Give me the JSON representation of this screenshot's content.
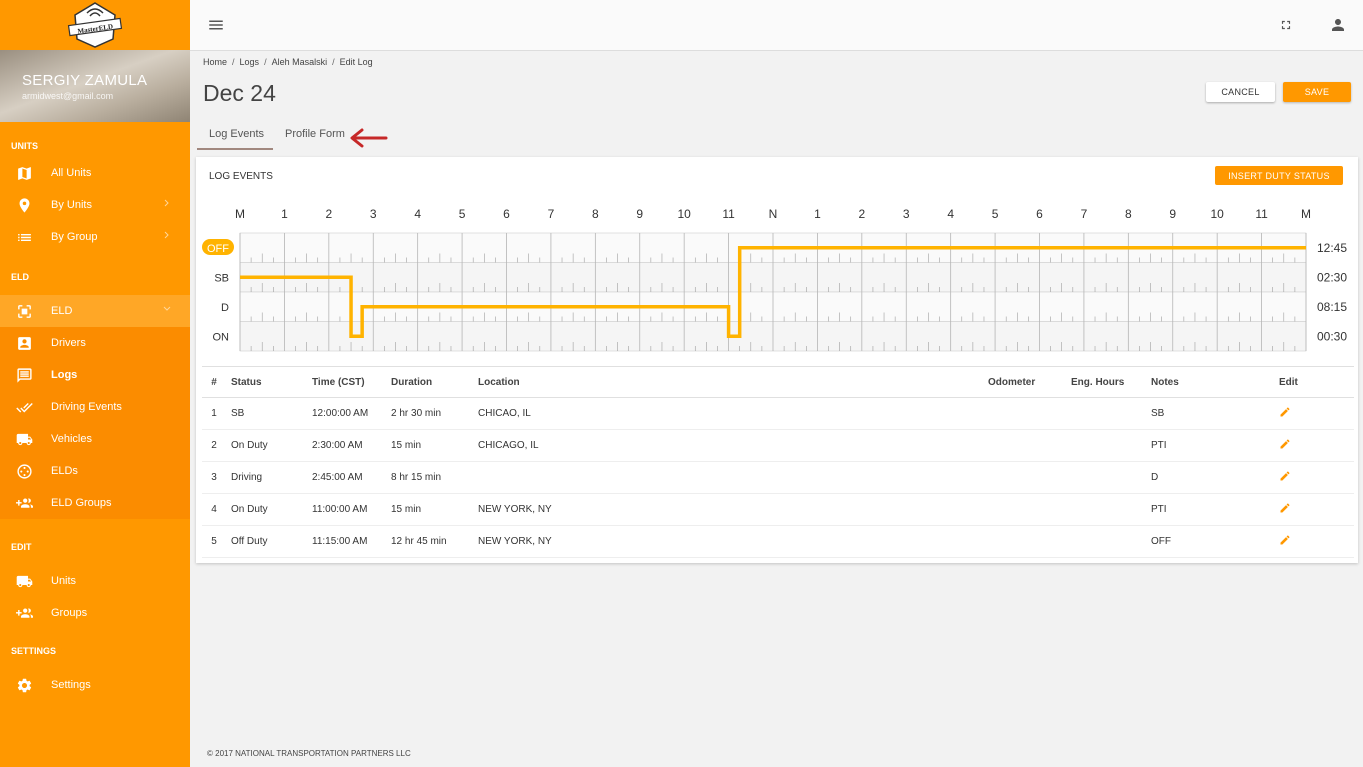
{
  "app": {
    "logo_text": "MasterELD"
  },
  "user": {
    "name": "SERGIY ZAMULA",
    "email": "armidwest@gmail.com"
  },
  "sidebar": {
    "sections": {
      "units": "UNITS",
      "eld": "ELD",
      "edit": "EDIT",
      "settings": "SETTINGS"
    },
    "items": {
      "all_units": "All Units",
      "by_units": "By Units",
      "by_group": "By Group",
      "eld": "ELD",
      "drivers": "Drivers",
      "logs": "Logs",
      "driving_events": "Driving Events",
      "vehicles": "Vehicles",
      "elds": "ELDs",
      "eld_groups": "ELD Groups",
      "units": "Units",
      "groups": "Groups",
      "settings": "Settings"
    }
  },
  "breadcrumb": [
    "Home",
    "Logs",
    "Aleh Masalski",
    "Edit Log"
  ],
  "page": {
    "title": "Dec 24",
    "cancel_label": "CANCEL",
    "save_label": "SAVE"
  },
  "tabs": {
    "log_events": "Log Events",
    "profile_form": "Profile Form"
  },
  "card": {
    "title": "LOG EVENTS",
    "insert_label": "INSERT DUTY STATUS"
  },
  "chart_data": {
    "type": "line",
    "hour_labels": [
      "M",
      "1",
      "2",
      "3",
      "4",
      "5",
      "6",
      "7",
      "8",
      "9",
      "10",
      "11",
      "N",
      "1",
      "2",
      "3",
      "4",
      "5",
      "6",
      "7",
      "8",
      "9",
      "10",
      "11",
      "M"
    ],
    "rows": [
      "OFF",
      "SB",
      "D",
      "ON"
    ],
    "totals": [
      "12:45",
      "02:30",
      "08:15",
      "00:30"
    ],
    "segments": [
      {
        "status": "SB",
        "start": 0,
        "end": 2.5
      },
      {
        "status": "ON",
        "start": 2.5,
        "end": 2.75
      },
      {
        "status": "D",
        "start": 2.75,
        "end": 11
      },
      {
        "status": "ON",
        "start": 11,
        "end": 11.25
      },
      {
        "status": "OFF",
        "start": 11.25,
        "end": 24
      }
    ],
    "active_row": "OFF",
    "line_color": "#ffb300"
  },
  "table": {
    "headers": [
      "#",
      "Status",
      "Time (CST)",
      "Duration",
      "Location",
      "Odometer",
      "Eng. Hours",
      "Notes",
      "Edit"
    ],
    "rows": [
      {
        "num": "1",
        "status": "SB",
        "time": "12:00:00 AM",
        "duration": "2 hr 30 min",
        "location": "CHICAO, IL",
        "odometer": "",
        "eng_hours": "",
        "notes": "SB"
      },
      {
        "num": "2",
        "status": "On Duty",
        "time": "2:30:00 AM",
        "duration": "15 min",
        "location": "CHICAGO, IL",
        "odometer": "",
        "eng_hours": "",
        "notes": "PTI"
      },
      {
        "num": "3",
        "status": "Driving",
        "time": "2:45:00 AM",
        "duration": "8 hr 15 min",
        "location": "",
        "odometer": "",
        "eng_hours": "",
        "notes": "D"
      },
      {
        "num": "4",
        "status": "On Duty",
        "time": "11:00:00 AM",
        "duration": "15 min",
        "location": "NEW YORK, NY",
        "odometer": "",
        "eng_hours": "",
        "notes": "PTI"
      },
      {
        "num": "5",
        "status": "Off Duty",
        "time": "11:15:00 AM",
        "duration": "12 hr 45 min",
        "location": "NEW YORK, NY",
        "odometer": "",
        "eng_hours": "",
        "notes": "OFF"
      }
    ]
  },
  "footer": {
    "text": "© 2017 NATIONAL TRANSPORTATION PARTNERS LLC"
  },
  "colors": {
    "accent": "#ff9800",
    "arrow": "#c62828",
    "edit_icon": "#ff9800"
  }
}
